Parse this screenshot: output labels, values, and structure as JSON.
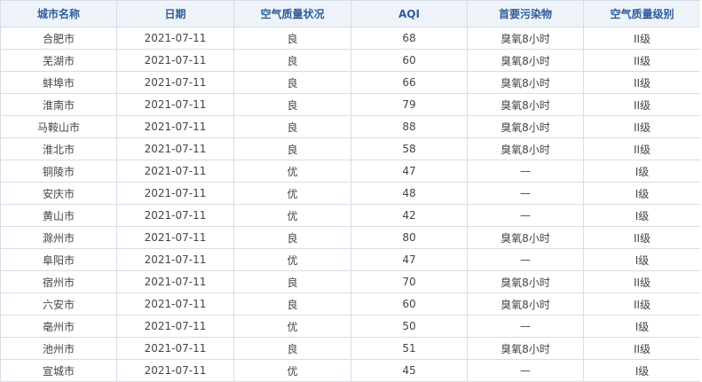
{
  "table": {
    "headers": [
      "城市名称",
      "日期",
      "空气质量状况",
      "AQI",
      "首要污染物",
      "空气质量级别"
    ],
    "rows": [
      [
        "合肥市",
        "2021-07-11",
        "良",
        "68",
        "臭氧8小时",
        "II级"
      ],
      [
        "芜湖市",
        "2021-07-11",
        "良",
        "60",
        "臭氧8小时",
        "II级"
      ],
      [
        "蚌埠市",
        "2021-07-11",
        "良",
        "66",
        "臭氧8小时",
        "II级"
      ],
      [
        "淮南市",
        "2021-07-11",
        "良",
        "79",
        "臭氧8小时",
        "II级"
      ],
      [
        "马鞍山市",
        "2021-07-11",
        "良",
        "88",
        "臭氧8小时",
        "II级"
      ],
      [
        "淮北市",
        "2021-07-11",
        "良",
        "58",
        "臭氧8小时",
        "II级"
      ],
      [
        "铜陵市",
        "2021-07-11",
        "优",
        "47",
        "—",
        "I级"
      ],
      [
        "安庆市",
        "2021-07-11",
        "优",
        "48",
        "—",
        "I级"
      ],
      [
        "黄山市",
        "2021-07-11",
        "优",
        "42",
        "—",
        "I级"
      ],
      [
        "滁州市",
        "2021-07-11",
        "良",
        "80",
        "臭氧8小时",
        "II级"
      ],
      [
        "阜阳市",
        "2021-07-11",
        "优",
        "47",
        "—",
        "I级"
      ],
      [
        "宿州市",
        "2021-07-11",
        "良",
        "70",
        "臭氧8小时",
        "II级"
      ],
      [
        "六安市",
        "2021-07-11",
        "良",
        "60",
        "臭氧8小时",
        "II级"
      ],
      [
        "亳州市",
        "2021-07-11",
        "优",
        "50",
        "—",
        "I级"
      ],
      [
        "池州市",
        "2021-07-11",
        "良",
        "51",
        "臭氧8小时",
        "II级"
      ],
      [
        "宣城市",
        "2021-07-11",
        "优",
        "45",
        "—",
        "I级"
      ]
    ]
  },
  "colors": {
    "header_bg": "#eef3fa",
    "header_text": "#2f5d9a",
    "border": "#d4dde8",
    "cell_text": "#444444"
  }
}
